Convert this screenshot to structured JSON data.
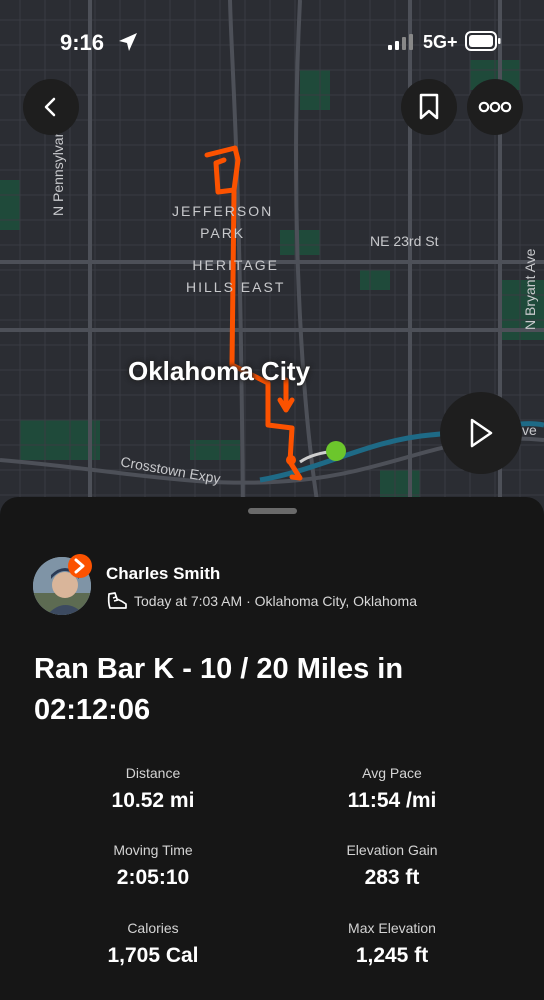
{
  "status_bar": {
    "time": "9:16",
    "network": "5G+"
  },
  "map": {
    "labels": {
      "jefferson_park": "JEFFERSON\nPARK",
      "heritage_hills": "HERITAGE\nHILLS EAST",
      "city": "Oklahoma City",
      "ne_23rd": "NE 23rd St",
      "n_pennsylvania": "N Pennsylvania Ave",
      "n_bryant": "N Bryant Ave",
      "crosstown": "Crosstown Expy",
      "ave_fragment": "ve"
    },
    "route_color": "#fc5200",
    "end_marker_color": "#6cc62c"
  },
  "activity": {
    "athlete_name": "Charles Smith",
    "meta": "Today at 7:03 AM · Oklahoma City, Oklahoma",
    "title": "Ran Bar K - 10 / 20 Miles in 02:12:06",
    "stats": [
      {
        "label": "Distance",
        "value": "10.52 mi"
      },
      {
        "label": "Avg Pace",
        "value": "11:54 /mi"
      },
      {
        "label": "Moving Time",
        "value": "2:05:10"
      },
      {
        "label": "Elevation Gain",
        "value": "283 ft"
      },
      {
        "label": "Calories",
        "value": "1,705 Cal"
      },
      {
        "label": "Max Elevation",
        "value": "1,245 ft"
      }
    ]
  }
}
